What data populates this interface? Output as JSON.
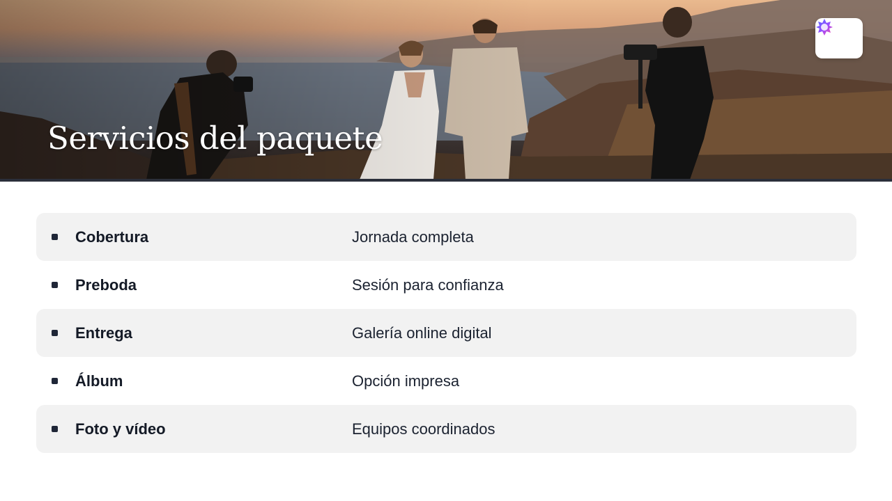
{
  "header": {
    "title": "Servicios del paquete",
    "logo_icon": "star-logo-icon"
  },
  "services": [
    {
      "label": "Cobertura",
      "value": "Jornada completa",
      "shaded": true
    },
    {
      "label": "Preboda",
      "value": "Sesión para confianza",
      "shaded": false
    },
    {
      "label": "Entrega",
      "value": "Galería online digital",
      "shaded": true
    },
    {
      "label": "Álbum",
      "value": "Opción impresa",
      "shaded": false
    },
    {
      "label": "Foto y vídeo",
      "value": "Equipos coordinados",
      "shaded": true
    }
  ],
  "colors": {
    "row_shade": "#f2f2f2",
    "bullet": "#1f2637",
    "text": "#141a26"
  }
}
